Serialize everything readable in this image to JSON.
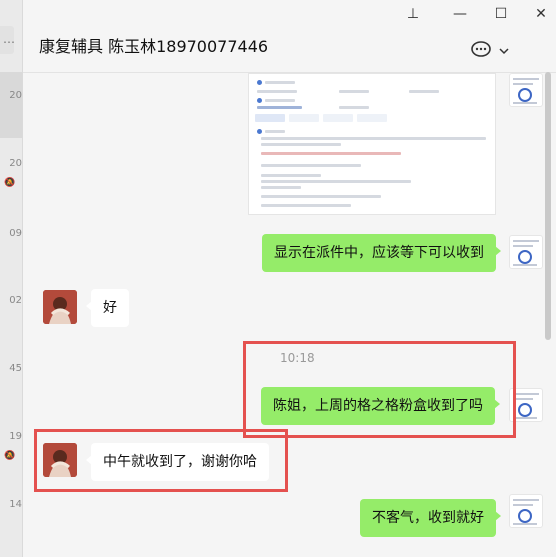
{
  "window": {
    "pin_glyph": "⊥",
    "minimize_glyph": "—",
    "maximize_glyph": "☐",
    "close_glyph": "✕"
  },
  "chat": {
    "title": "康复辅具 陈玉林18970077446",
    "more_glyph": "💬",
    "chevron_glyph": "⌄"
  },
  "session_list": {
    "corner_glyph": "…",
    "items": [
      {
        "time": "20"
      },
      {
        "time": "20",
        "muted_glyph": "🔕"
      },
      {
        "time": "09"
      },
      {
        "time": "02"
      },
      {
        "time": "45"
      },
      {
        "time": "19",
        "muted_glyph": "🔕"
      },
      {
        "time": "14"
      }
    ]
  },
  "messages": {
    "m1": {
      "text": "显示在派件中，应该等下可以收到"
    },
    "m2": {
      "text": "好"
    },
    "timestamp": "10:18",
    "m3": {
      "text": "陈姐，上周的格之格粉盒收到了吗"
    },
    "m4": {
      "text": "中午就收到了，谢谢你哈"
    },
    "m5": {
      "text": "不客气，收到就好"
    }
  },
  "colors": {
    "me_bubble": "#95ec69",
    "other_bubble": "#ffffff",
    "highlight": "#e4514f",
    "background": "#f5f5f5"
  }
}
